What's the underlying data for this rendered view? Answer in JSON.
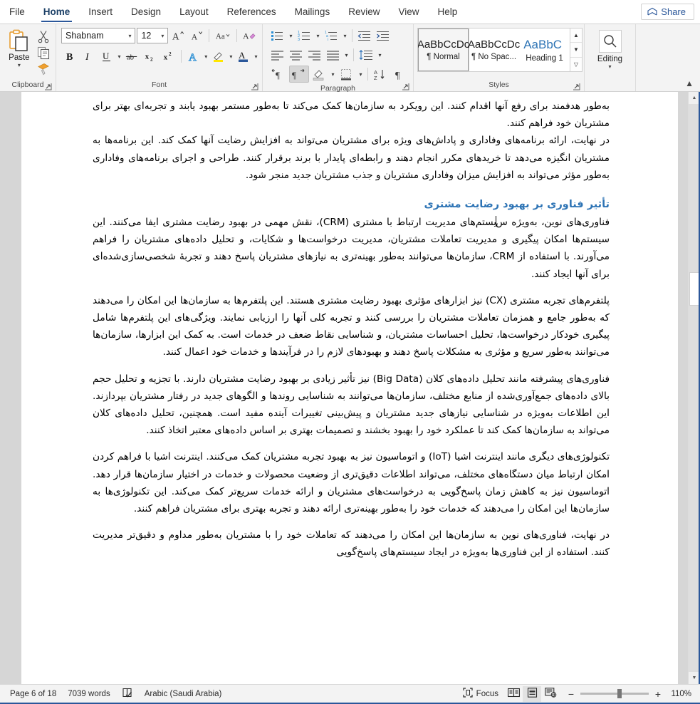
{
  "window": {
    "share_label": "Share"
  },
  "tabs": [
    {
      "label": "File",
      "active": false
    },
    {
      "label": "Home",
      "active": true
    },
    {
      "label": "Insert",
      "active": false
    },
    {
      "label": "Design",
      "active": false
    },
    {
      "label": "Layout",
      "active": false
    },
    {
      "label": "References",
      "active": false
    },
    {
      "label": "Mailings",
      "active": false
    },
    {
      "label": "Review",
      "active": false
    },
    {
      "label": "View",
      "active": false
    },
    {
      "label": "Help",
      "active": false
    }
  ],
  "ribbon": {
    "clipboard": {
      "group_label": "Clipboard",
      "paste_label": "Paste",
      "cut_name": "cut",
      "copy_name": "copy",
      "format_painter_name": "format-painter"
    },
    "font": {
      "group_label": "Font",
      "font_name": "Shabnam",
      "font_size": "12",
      "grow_font": "A",
      "shrink_font": "A",
      "change_case": "Aa",
      "clear_formatting": "A",
      "bold": "B",
      "italic": "I",
      "underline": "U",
      "strikethrough": "ab",
      "subscript": "x",
      "superscript": "x",
      "text_effects": "A",
      "highlight": "A",
      "font_color": "A"
    },
    "paragraph": {
      "group_label": "Paragraph",
      "bullets": "bullets",
      "numbering": "numbering",
      "multilevel": "multilevel-list",
      "decrease_indent": "decrease-indent",
      "increase_indent": "increase-indent",
      "align_left": "align-left",
      "align_center": "align-center",
      "align_right": "align-right",
      "justify": "justify",
      "line_spacing": "line-spacing",
      "ltr": "left-to-right",
      "rtl": "right-to-left",
      "shading": "shading",
      "borders": "borders",
      "sort": "sort",
      "show_marks": "show-formatting-marks"
    },
    "styles": {
      "group_label": "Styles",
      "items": [
        {
          "preview": "AaBbCcDc",
          "name": "¶ Normal",
          "selected": true
        },
        {
          "preview": "AaBbCcDc",
          "name": "¶ No Spac...",
          "selected": false
        },
        {
          "preview": "AaBbC ",
          "name": "Heading 1",
          "selected": false
        }
      ]
    },
    "editing": {
      "group_label": "",
      "label": "Editing"
    }
  },
  "document": {
    "paragraphs": [
      {
        "type": "p",
        "text": "به‌طور هدفمند برای رفع آنها اقدام کنند. این رویکرد به سازمان‌ها کمک می‌کند تا به‌طور مستمر بهبود یابند و تجربه‌ای بهتر برای مشتریان خود فراهم کنند."
      },
      {
        "type": "p",
        "text": "در نهایت، ارائه برنامه‌های وفاداری و پاداش‌های ویژه برای مشتریان می‌تواند به افزایش رضایت آنها کمک کند. این برنامه‌ها به مشتریان انگیزه می‌دهد تا خریدهای مکرر انجام دهند و رابطه‌ای پایدار با برند برقرار کنند. طراحی و اجرای برنامه‌های وفاداری به‌طور مؤثر می‌تواند به افزایش میزان وفاداری مشتریان و جذب مشتریان جدید منجر شود."
      },
      {
        "type": "h2",
        "text": "تأثیر فناوری بر بهبود رضایت مشتری"
      },
      {
        "type": "p_caret",
        "text_before": "فناوری‌های نوین، به‌ویژه س",
        "text_after": "یستم‌های مدیریت ارتباط با مشتری (CRM)، نقش مهمی در بهبود رضایت مشتری ایفا می‌کنند. این سیستم‌ها امکان پیگیری و مدیریت تعاملات مشتریان، مدیریت درخواست‌ها و شکایات، و تحلیل داده‌های مشتریان را فراهم می‌آورند. با استفاده از CRM، سازمان‌ها می‌توانند به‌طور بهینه‌تری به نیازهای مشتریان پاسخ دهند و تجربهٔ شخصی‌سازی‌شده‌ای برای آنها ایجاد کنند."
      },
      {
        "type": "p",
        "text": "پلتفرم‌های تجربه مشتری (CX) نیز ابزارهای مؤثری بهبود رضایت مشتری هستند. این پلتفرم‌ها به سازمان‌ها این امکان را می‌دهند که به‌طور جامع و همزمان تعاملات مشتریان را بررسی کنند و تجربه کلی آنها را ارزیابی نمایند. ویژگی‌های این پلتفرم‌ها شامل پیگیری خودکار درخواست‌ها، تحلیل احساسات مشتریان، و شناسایی نقاط ضعف در خدمات است. به کمک این ابزارها، سازمان‌ها می‌توانند به‌طور سریع و مؤثری به مشکلات پاسخ دهند و بهبودهای لازم را در فرآیندها و خدمات خود اعمال کنند."
      },
      {
        "type": "p",
        "text": "فناوری‌های پیشرفته مانند تحلیل داده‌های کلان (Big Data) نیز تأثیر زیادی بر بهبود رضایت مشتریان دارند. با تجزیه و تحلیل حجم بالای داده‌های جمع‌آوری‌شده از منابع مختلف، سازمان‌ها می‌توانند به شناسایی روندها و الگوهای جدید در رفتار مشتریان بپردازند. این اطلاعات به‌ویژه در شناسایی نیازهای جدید مشتریان و پیش‌بینی تغییرات آینده مفید است. همچنین، تحلیل داده‌های کلان می‌تواند به سازمان‌ها کمک کند تا عملکرد خود را بهبود بخشند و تصمیمات بهتری بر اساس داده‌های معتبر اتخاذ کنند."
      },
      {
        "type": "p",
        "text": "تکنولوژی‌های دیگری مانند اینترنت اشیا (IoT) و اتوماسیون نیز به بهبود تجربه مشتریان کمک می‌کنند. اینترنت اشیا با فراهم کردن امکان ارتباط میان دستگاه‌های مختلف، می‌تواند اطلاعات دقیق‌تری از وضعیت محصولات و خدمات در اختیار سازمان‌ها قرار دهد. اتوماسیون نیز به کاهش زمان پاسخ‌گویی به درخواست‌های مشتریان و ارائه خدمات سریع‌تر کمک می‌کند. این تکنولوژی‌ها به سازمان‌ها این امکان را می‌دهند که خدمات خود را به‌طور بهینه‌تری ارائه دهند و تجربه بهتری برای مشتریان فراهم کنند."
      },
      {
        "type": "p",
        "text": "در نهایت، فناوری‌های نوین به سازمان‌ها این امکان را می‌دهند که تعاملات خود را با مشتریان به‌طور مداوم و دقیق‌تر مدیریت کنند. استفاده از این فناوری‌ها به‌ویژه در ایجاد سیستم‌های پاسخ‌گویی"
      }
    ]
  },
  "statusbar": {
    "page": "Page 6 of 18",
    "words": "7039 words",
    "proofing_icon": "proofing-icon",
    "language": "Arabic (Saudi Arabia)",
    "focus": "Focus",
    "view_read": "read-mode",
    "view_print": "print-layout",
    "view_web": "web-layout",
    "zoom_minus": "−",
    "zoom_plus": "+",
    "zoom_value": "110%"
  },
  "colors": {
    "accent": "#2b579a",
    "heading": "#2e74b5",
    "ribbon_bg": "#f3f3f3",
    "doc_bg": "#d6d6d6"
  }
}
